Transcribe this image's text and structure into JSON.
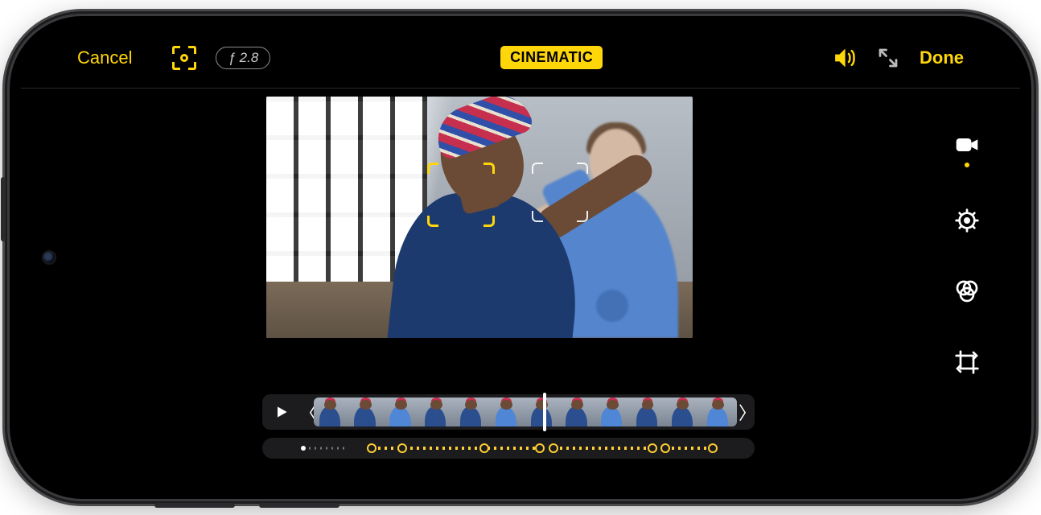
{
  "colors": {
    "accent": "#ffd60a"
  },
  "topbar": {
    "cancel": "Cancel",
    "aperture_label": "ƒ 2.8",
    "mode_badge": "CINEMATIC",
    "done": "Done",
    "audio_on": true
  },
  "preview": {
    "primary_focus": "person-foreground",
    "secondary_focus": "person-background"
  },
  "tools": {
    "items": [
      {
        "id": "video",
        "label": "Video",
        "selected": true
      },
      {
        "id": "adjust",
        "label": "Adjust",
        "selected": false
      },
      {
        "id": "filters",
        "label": "Filters",
        "selected": false
      },
      {
        "id": "crop",
        "label": "Crop",
        "selected": false
      }
    ]
  },
  "timeline": {
    "playing": false,
    "playhead_pct": 57,
    "thumb_count": 12,
    "focus_track": {
      "segments": [
        {
          "start_pct": 15,
          "end_pct": 54
        },
        {
          "start_pct": 57,
          "end_pct": 80
        },
        {
          "start_pct": 83,
          "end_pct": 94
        }
      ],
      "keyframes_pct": [
        15,
        22,
        41,
        54,
        57,
        80,
        83,
        94
      ]
    }
  }
}
